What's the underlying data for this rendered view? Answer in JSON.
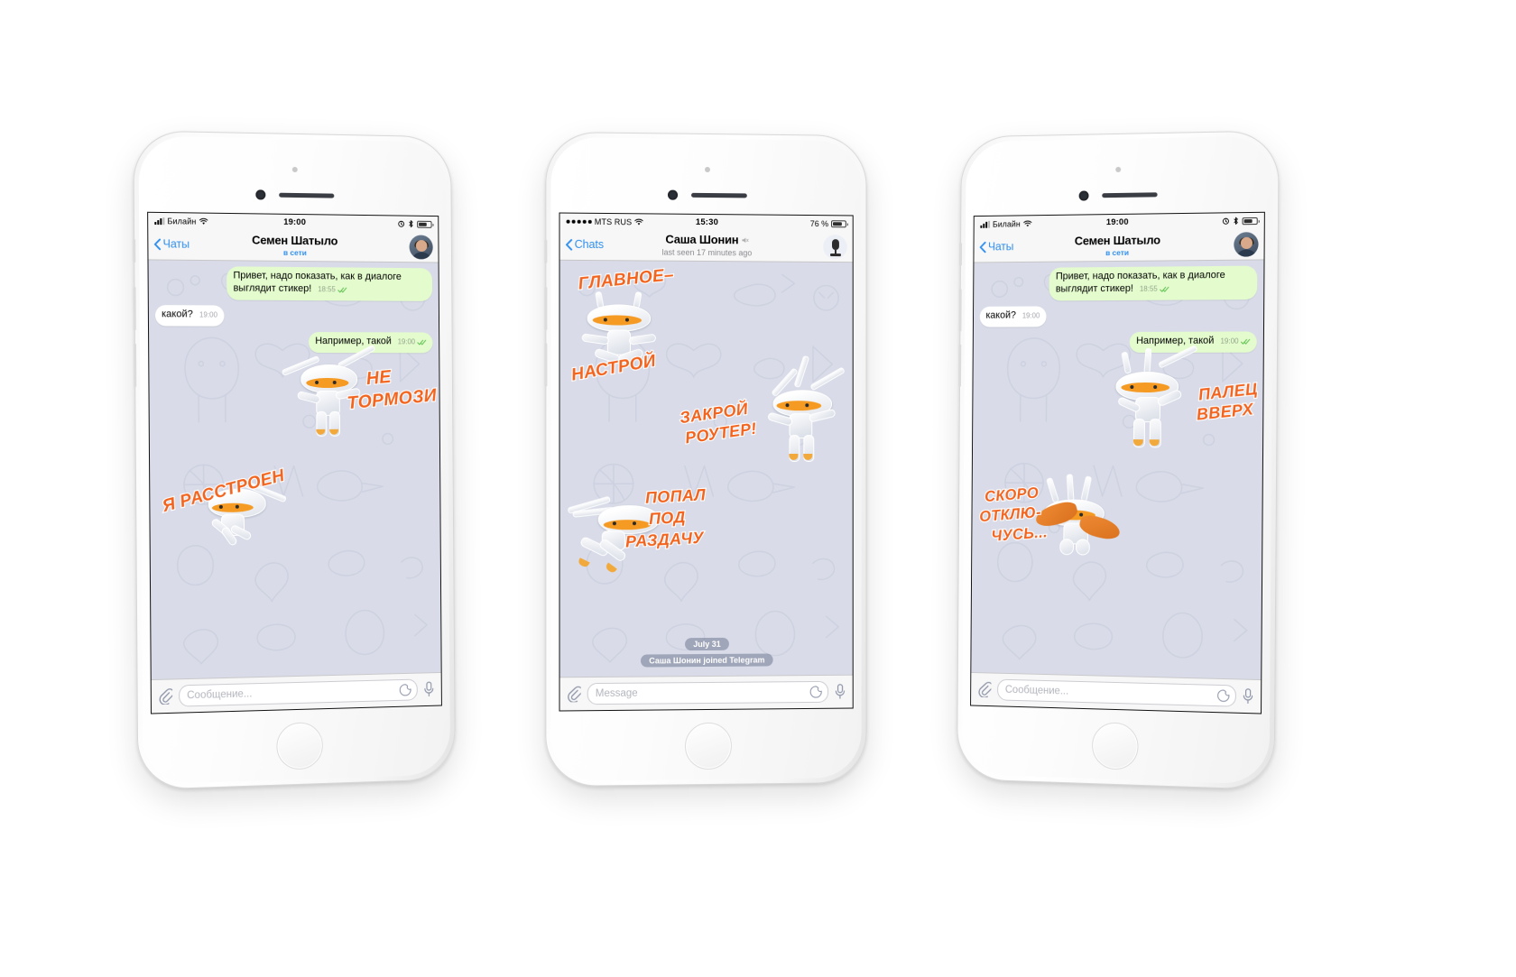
{
  "app": {
    "name": "Telegram iOS chat"
  },
  "phones": [
    {
      "id": "phone-left",
      "statusbar": {
        "carrier": "Билайн",
        "signal_style": "bars",
        "time": "19:00",
        "battery_percent": "",
        "icons": [
          "alarm-icon",
          "bluetooth-icon",
          "battery-icon"
        ]
      },
      "navbar": {
        "back_label": "Чаты",
        "title": "Семен Шатыло",
        "subtitle": "в сети",
        "subtitle_color": "#2f8fee",
        "muted": false,
        "avatar": "user-photo"
      },
      "messages": [
        {
          "dir": "out",
          "text": "Привет, надо показать, как в диалоге выглядит стикер!",
          "time": "18:55",
          "ticks": true
        },
        {
          "dir": "in",
          "text": "какой?",
          "time": "19:00",
          "ticks": false
        },
        {
          "dir": "out",
          "text": "Например, такой",
          "time": "19:00",
          "ticks": true
        }
      ],
      "stickers": [
        {
          "name": "ne-tormozi",
          "caption": [
            "НЕ",
            "ТОРМОЗИ"
          ]
        },
        {
          "name": "ya-rasstroen",
          "caption": [
            "Я РАССТРОЕН"
          ]
        }
      ],
      "input": {
        "placeholder": "Сообщение...",
        "attach": "paperclip-icon",
        "stickers": "sticker-icon",
        "voice": "microphone-icon"
      }
    },
    {
      "id": "phone-center",
      "statusbar": {
        "carrier": "MTS RUS",
        "signal_style": "dots",
        "time": "15:30",
        "battery_percent": "76 %",
        "icons": [
          "battery-icon"
        ]
      },
      "navbar": {
        "back_label": "Chats",
        "title": "Саша Шонин",
        "subtitle": "last seen 17 minutes ago",
        "subtitle_color": "#8a8a90",
        "muted": true,
        "avatar": "microphone-photo"
      },
      "messages": [],
      "stickers": [
        {
          "name": "glavnoe-nastroy",
          "caption": [
            "ГЛАВНОЕ–",
            "НАСТРОЙ"
          ]
        },
        {
          "name": "zakroy-router",
          "caption": [
            "ЗАКРОЙ",
            "РОУТЕР!"
          ]
        },
        {
          "name": "popal-pod-razdachu",
          "caption": [
            "ПОПАЛ",
            "ПОД",
            "РАЗДАЧУ"
          ]
        }
      ],
      "date_pill": "July 31",
      "service_message": "Саша Шонин joined Telegram",
      "input": {
        "placeholder": "Message",
        "attach": "paperclip-icon",
        "stickers": "sticker-icon",
        "voice": "microphone-icon"
      }
    },
    {
      "id": "phone-right",
      "statusbar": {
        "carrier": "Билайн",
        "signal_style": "bars",
        "time": "19:00",
        "battery_percent": "",
        "icons": [
          "alarm-icon",
          "bluetooth-icon",
          "battery-icon"
        ]
      },
      "navbar": {
        "back_label": "Чаты",
        "title": "Семен Шатыло",
        "subtitle": "в сети",
        "subtitle_color": "#2f8fee",
        "muted": false,
        "avatar": "user-photo"
      },
      "messages": [
        {
          "dir": "out",
          "text": "Привет, надо показать, как в диалоге выглядит стикер!",
          "time": "18:55",
          "ticks": true
        },
        {
          "dir": "in",
          "text": "какой?",
          "time": "19:00",
          "ticks": false
        },
        {
          "dir": "out",
          "text": "Например, такой",
          "time": "19:00",
          "ticks": true
        }
      ],
      "stickers": [
        {
          "name": "palec-vverh",
          "caption": [
            "ПАЛЕЦ",
            "ВВЕРХ"
          ]
        },
        {
          "name": "skoro-otklyuchus",
          "caption": [
            "СКОРО",
            "ОТКЛЮ-",
            "ЧУСЬ..."
          ]
        }
      ],
      "input": {
        "placeholder": "Сообщение...",
        "attach": "paperclip-icon",
        "stickers": "sticker-icon",
        "voice": "microphone-icon"
      }
    }
  ],
  "colors": {
    "accent": "#2f8fee",
    "bubble_out": "#e3fbcd",
    "bubble_in": "#ffffff",
    "chat_bg": "#d9dce8",
    "sticker_text": "#f2641e",
    "tick": "#5ec14e"
  }
}
